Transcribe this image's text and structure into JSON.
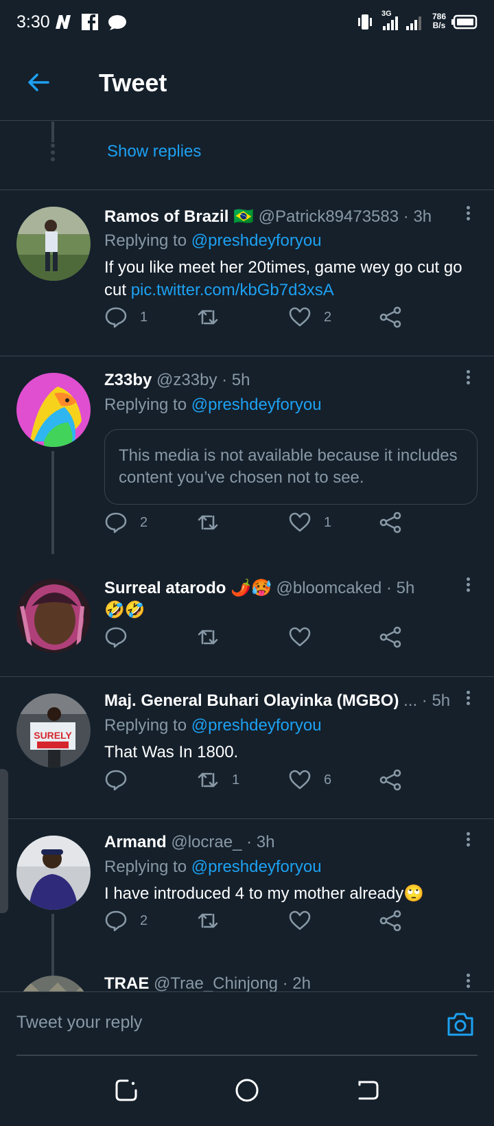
{
  "status_bar": {
    "time": "3:30",
    "net_speed_top": "786",
    "net_speed_bottom": "B/s",
    "network": "3G"
  },
  "header": {
    "title": "Tweet"
  },
  "thread_top": {
    "show_replies": "Show replies"
  },
  "tweets": [
    {
      "name": "Ramos of Brazil",
      "flag": "🇧🇷",
      "handle": "@Patrick89473583",
      "time": "· 3h",
      "replying_prefix": "Replying to",
      "replying_to": "@preshdeyforyou",
      "text": "If you like meet her 20times, game wey go cut go cut",
      "link": "pic.twitter.com/kbGb7d3xsA",
      "replies": "1",
      "retweets": "",
      "likes": "2"
    },
    {
      "name": "Z33by",
      "handle": "@z33by",
      "time": "· 5h",
      "replying_prefix": "Replying to",
      "replying_to": "@preshdeyforyou",
      "media_notice": "This media is not available because it includes content you’ve chosen not to see.",
      "replies": "2",
      "retweets": "",
      "likes": "1"
    },
    {
      "name": "Surreal atarodo 🌶️🥵",
      "handle": "@bloomcaked",
      "time": "· 5h",
      "text": "🤣🤣",
      "replies": "",
      "retweets": "",
      "likes": ""
    },
    {
      "name": "Maj. General Buhari Olayinka (MGBO)",
      "handle": "...",
      "time": "· 5h",
      "replying_prefix": "Replying to",
      "replying_to": "@preshdeyforyou",
      "text": "That Was In 1800.",
      "replies": "",
      "retweets": "1",
      "likes": "6"
    },
    {
      "name": "Armand",
      "handle": "@locrae_",
      "time": "· 3h",
      "replying_prefix": "Replying to",
      "replying_to": "@preshdeyforyou",
      "text": "I have introduced 4 to my mother already🙄",
      "replies": "2",
      "retweets": "",
      "likes": ""
    },
    {
      "name": "TRAE",
      "handle": "@Trae_Chinjong",
      "time": "· 2h"
    }
  ],
  "reply_bar": {
    "placeholder": "Tweet your reply"
  },
  "colors": {
    "background": "#15202b",
    "accent": "#1da1f2",
    "muted": "#8899a6",
    "border": "#38444d"
  },
  "icons": [
    "back-arrow-icon",
    "reply-icon",
    "retweet-icon",
    "like-icon",
    "share-icon",
    "more-icon",
    "camera-icon"
  ]
}
